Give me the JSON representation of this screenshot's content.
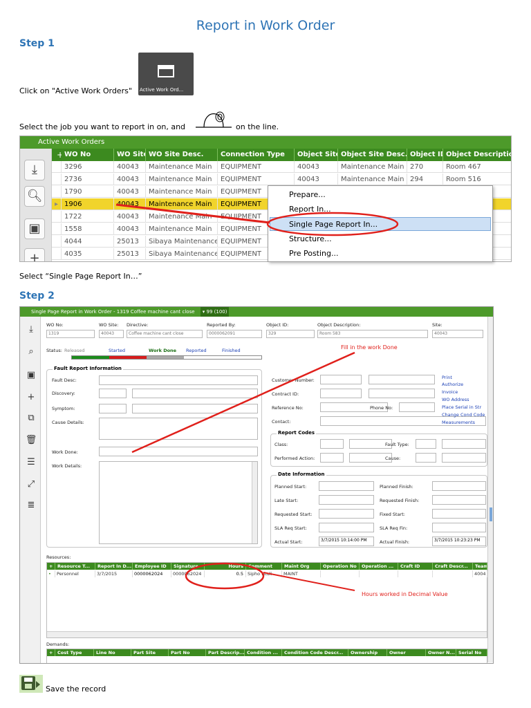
{
  "doc": {
    "title": "Report in Work Order",
    "step1": "Step 1",
    "click_text": "Click on \"Active Work Orders\"",
    "active_wo_button_label": "Active Work Ord...",
    "select_job_text": "Select the job you want to report in on, and",
    "on_the_line": "on the line.",
    "select_single_text": "Select “Single Page Report In…”",
    "step2": "Step 2",
    "save_text": "Save the record"
  },
  "active_grid": {
    "title": "Active Work Orders",
    "columns": [
      "WO No",
      "WO Site",
      "WO Site Desc.",
      "Connection Type",
      "Object Site",
      "Object Site Desc.",
      "Object ID",
      "Object Description"
    ],
    "rows": [
      [
        "3296",
        "40043",
        "Maintenance Main",
        "EQUIPMENT",
        "40043",
        "Maintenance Main",
        "270",
        "Room 467"
      ],
      [
        "2736",
        "40043",
        "Maintenance Main",
        "EQUIPMENT",
        "40043",
        "Maintenance Main",
        "294",
        "Room 516"
      ],
      [
        "1790",
        "40043",
        "Maintenance Main",
        "EQUIPMENT",
        "",
        "",
        "",
        ""
      ],
      [
        "1906",
        "40043",
        "Maintenance Main",
        "EQUIPMENT",
        "",
        "",
        "",
        ""
      ],
      [
        "1722",
        "40043",
        "Maintenance Main",
        "EQUIPMENT",
        "",
        "",
        "",
        ""
      ],
      [
        "1558",
        "40043",
        "Maintenance Main",
        "EQUIPMENT",
        "",
        "",
        "",
        ""
      ],
      [
        "4044",
        "25013",
        "Sibaya Maintenance",
        "EQUIPMENT",
        "",
        "",
        "",
        ""
      ],
      [
        "4035",
        "25013",
        "Sibaya Maintenance",
        "EQUIPMENT",
        "",
        "",
        "",
        ""
      ]
    ],
    "selected_row": 3
  },
  "context_menu": {
    "items": [
      "Prepare...",
      "Report In...",
      "Single Page Report In...",
      "Structure...",
      "Pre Posting..."
    ],
    "highlighted": 2
  },
  "report_window": {
    "title": "Single Page Report in Work Order - 1319 Coffee machine cant close",
    "nav_value": "99 (100)",
    "header": {
      "wo_no_label": "WO No:",
      "wo_no": "1319",
      "wo_site_label": "WO Site:",
      "wo_site": "40043",
      "directive_label": "Directive:",
      "directive": "Coffee machine cant close",
      "reported_by_label": "Reported By:",
      "reported_by": "0000062091",
      "object_id_label": "Object ID:",
      "object_id": "329",
      "object_desc_label": "Object Description:",
      "object_desc": "Room 583",
      "site_label": "Site:",
      "site": "40043"
    },
    "status": {
      "label": "Status:",
      "value": "Released",
      "steps": [
        "Started",
        "Work Done",
        "Reported",
        "Finished"
      ]
    },
    "fault_section": {
      "title": "Fault Report Information",
      "fault_desc": "Fault Desc:",
      "discovery": "Discovery:",
      "symptom": "Symptom:",
      "cause_details": "Cause Details:",
      "work_done": "Work Done:",
      "work_details": "Work Details:"
    },
    "customer": {
      "customer_number": "Customer Number:",
      "contract_id": "Contract ID:",
      "reference_no": "Reference No:",
      "phone_no": "Phone No:",
      "contact": "Contact:"
    },
    "links": [
      "Print",
      "Authorize",
      "Invoice",
      "WO Address",
      "Place Serial in Str",
      "Change Cond Code",
      "Measurements"
    ],
    "report_codes": {
      "title": "Report Codes",
      "class": "Class:",
      "fault_type": "Fault Type:",
      "performed_action": "Performed Action:",
      "cause": "Cause:"
    },
    "date_info": {
      "title": "Date Information",
      "planned_start": "Planned Start:",
      "planned_finish": "Planned Finish:",
      "late_start": "Late Start:",
      "requested_finish": "Requested Finish:",
      "requested_start": "Requested Start:",
      "fixed_start": "Fixed Start:",
      "sla_req_start": "SLA Req Start:",
      "sla_req_fin": "SLA Req Fin:",
      "actual_start": "Actual Start:",
      "actual_start_value": "3/7/2015 10:14:00 PM",
      "actual_finish": "Actual Finish:",
      "actual_finish_value": "3/7/2015 10:23:23 PM"
    },
    "resources": {
      "label": "Resources:",
      "columns": [
        "Resource T...",
        "Report In D...",
        "Employee ID",
        "Signature",
        "Hours",
        "Comment",
        "Maint Org",
        "Operation No",
        "Operation ...",
        "Craft ID",
        "Craft Descr...",
        "Team"
      ],
      "row": [
        "Personnel",
        "3/7/2015",
        "0000062024",
        "0000062024",
        "0.5",
        "Sipho Ntuli",
        "MAINT",
        "",
        "",
        "",
        "",
        "4004"
      ]
    },
    "demands": {
      "label": "Demands:",
      "columns": [
        "Cost Type",
        "Line No",
        "Part Site",
        "Part No",
        "Part Descrip...",
        "Condition ...",
        "Condition Code Descr...",
        "Ownership",
        "Owner",
        "Owner N...",
        "Serial No"
      ]
    },
    "annotations": {
      "fill_note": "Fill in the work Done",
      "hours_note": "Hours worked in Decimal Value"
    }
  },
  "colors": {
    "heading_blue": "#2e74b5",
    "grid_green": "#3c8a1f",
    "selected_row": "#f1d42b",
    "annotation_red": "#e0201b"
  }
}
